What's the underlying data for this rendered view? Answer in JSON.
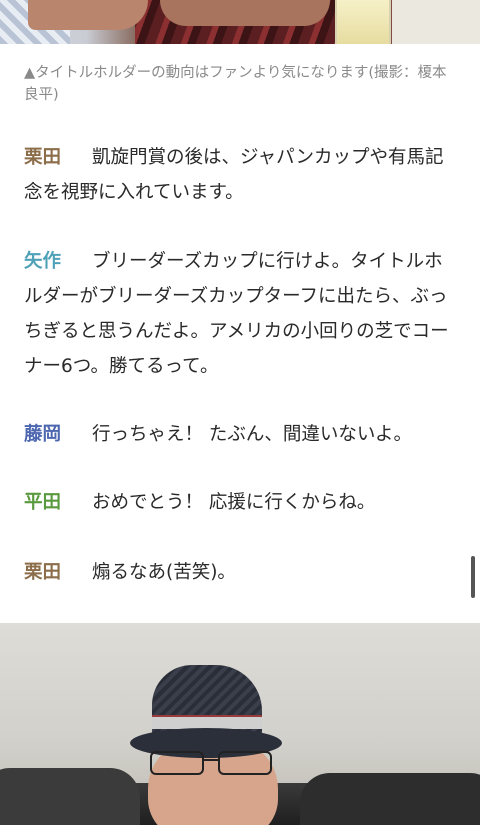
{
  "caption": "▲タイトルホルダーの動向はファンより気になります(撮影：榎本良平)",
  "dialog": [
    {
      "speaker": "栗田",
      "color": "#8c6d4a",
      "text": "凱旋門賞の後は、ジャパンカップや有馬記念を視野に入れています。"
    },
    {
      "speaker": "矢作",
      "color": "#4fa1b8",
      "text": "ブリーダーズカップに行けよ。タイトルホルダーがブリーダーズカップターフに出たら、ぶっちぎると思うんだよ。アメリカの小回りの芝でコーナー6つ。勝てるって。"
    },
    {
      "speaker": "藤岡",
      "color": "#4c66b0",
      "text": "行っちゃえ！ たぶん、間違いないよ。"
    },
    {
      "speaker": "平田",
      "color": "#5a9a3f",
      "text": "おめでとう！ 応援に行くからね。"
    },
    {
      "speaker": "栗田",
      "color": "#8c6d4a",
      "text": "煽るなあ(苦笑)。"
    }
  ]
}
